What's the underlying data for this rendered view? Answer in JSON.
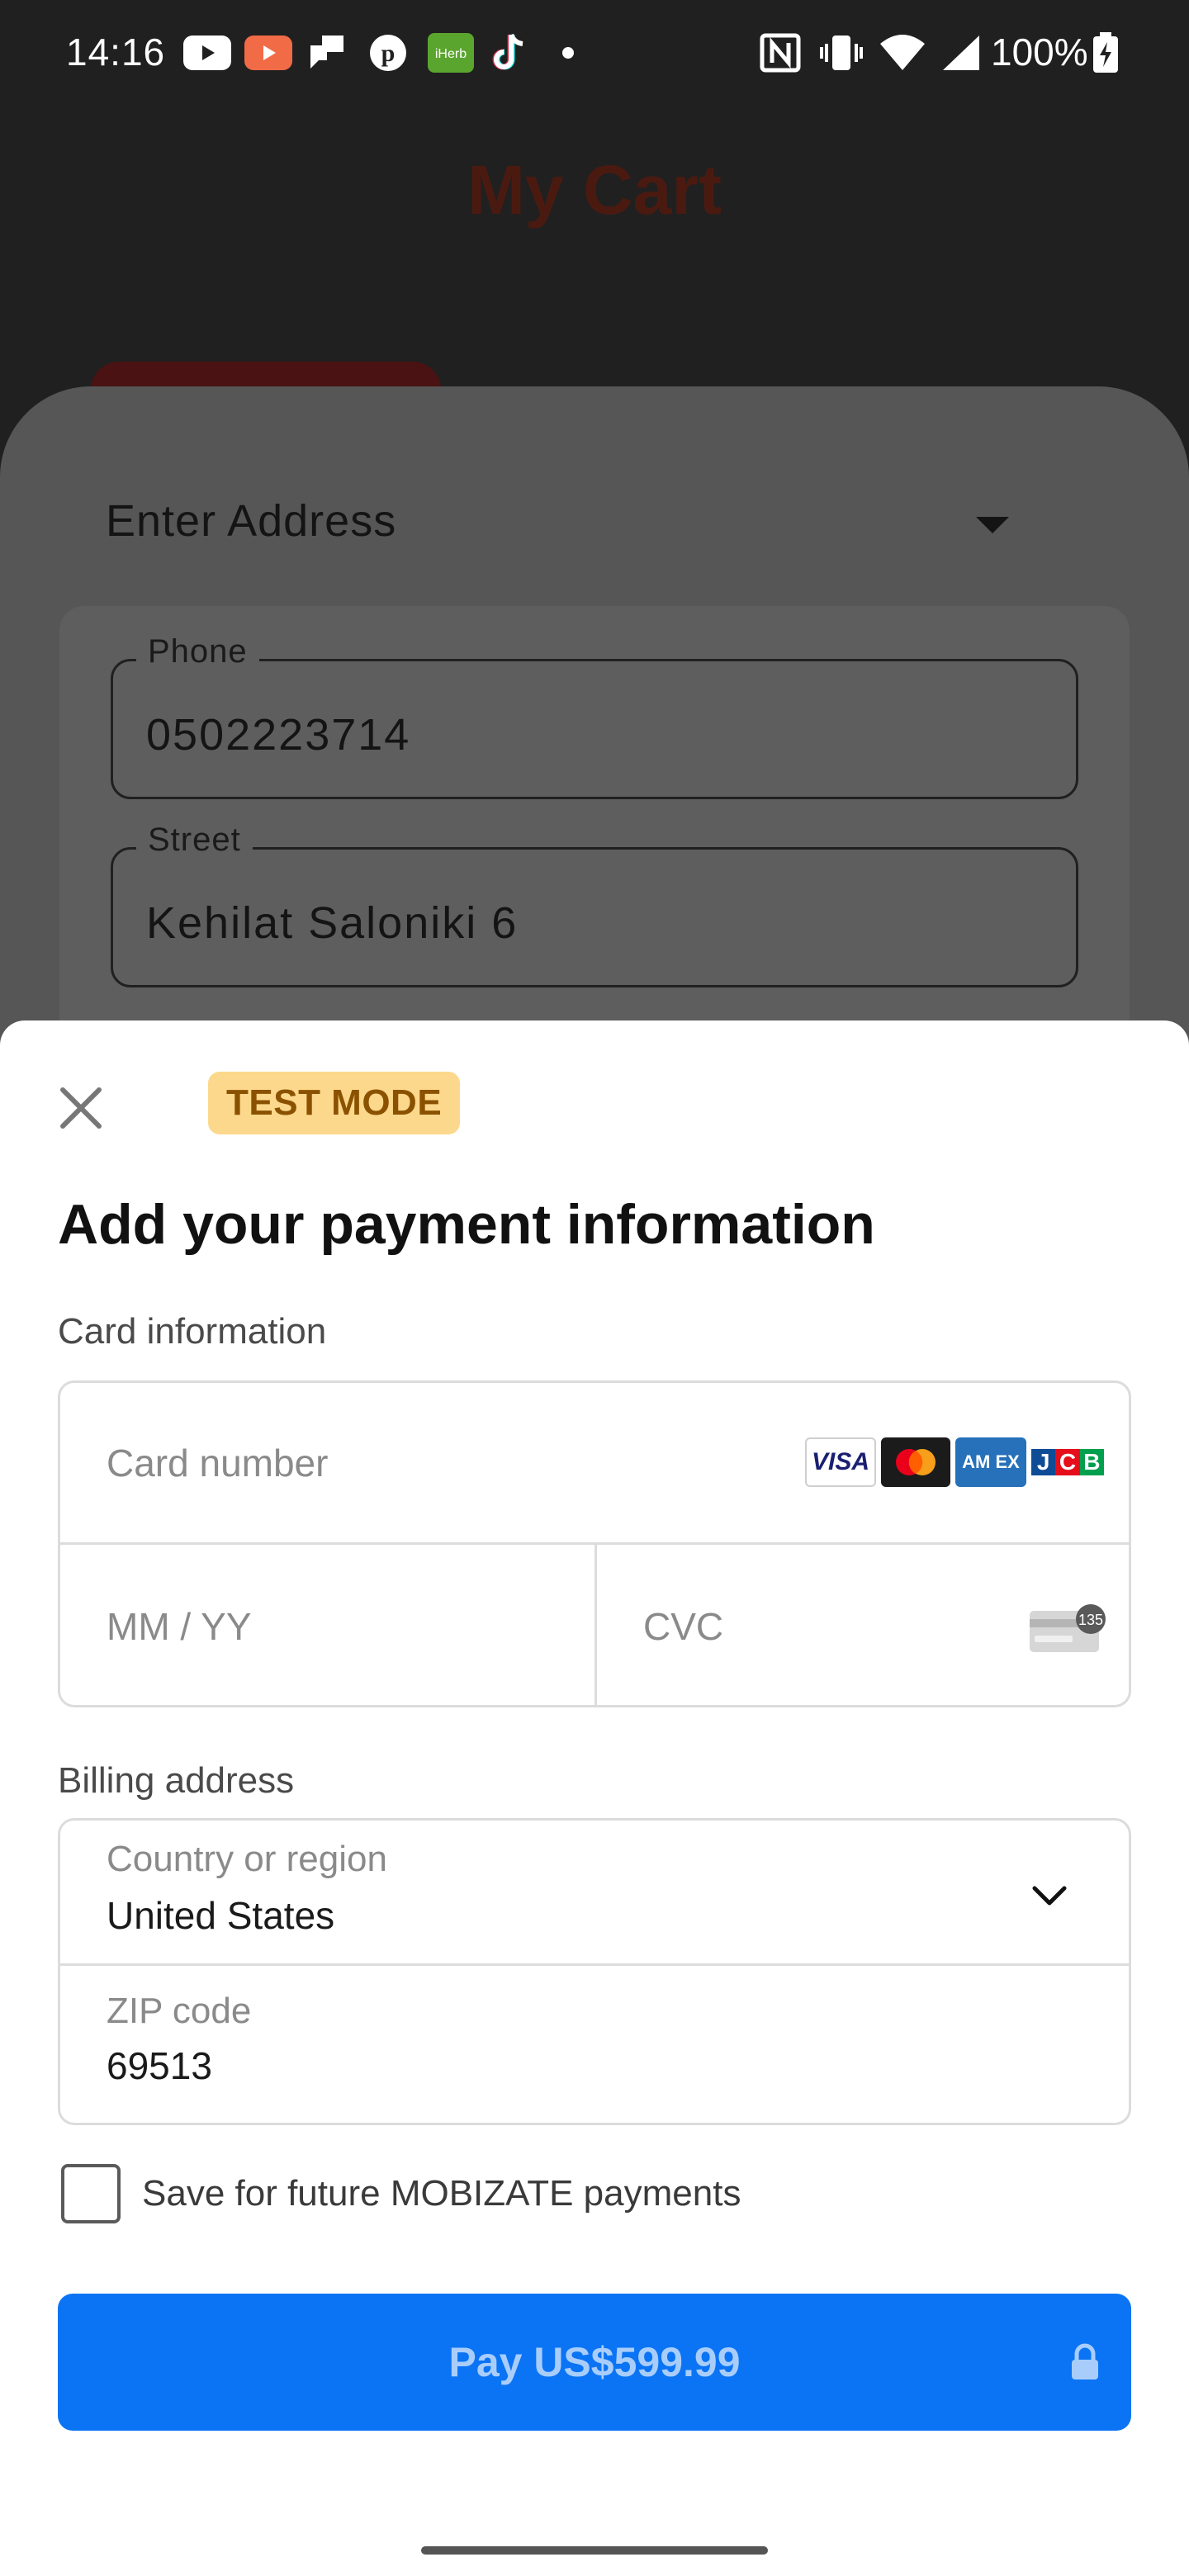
{
  "status_bar": {
    "time": "14:16",
    "battery": "100%",
    "notification_icons": [
      "youtube-icon",
      "youtube-studio-icon",
      "chat-icon",
      "pinterest-icon",
      "iherb-icon",
      "tiktok-icon",
      "dot-icon"
    ],
    "system_icons": [
      "nfc-icon",
      "vibrate-icon",
      "wifi-icon",
      "signal-icon",
      "battery-icon"
    ],
    "iherb_text": "iHerb"
  },
  "background": {
    "title": "My Cart",
    "address_dropdown_label": "Enter Address",
    "fields": [
      {
        "label": "Phone",
        "value": "0502223714"
      },
      {
        "label": "Street",
        "value": "Kehilat Saloniki 6"
      }
    ]
  },
  "payment": {
    "test_mode_badge": "TEST MODE",
    "title": "Add your payment information",
    "card_info_label": "Card information",
    "card_number_placeholder": "Card number",
    "card_brands": [
      "VISA",
      "mastercard",
      "AMEX",
      "JCB"
    ],
    "amex_text": "AM EX",
    "jcb_letters": [
      "J",
      "C",
      "B"
    ],
    "expiry_placeholder": "MM / YY",
    "cvc_placeholder": "CVC",
    "cvc_hint": "135",
    "billing_label": "Billing address",
    "country_label": "Country or region",
    "country_value": "United States",
    "zip_label": "ZIP code",
    "zip_value": "69513",
    "save_checkbox_label": "Save for future MOBIZATE payments",
    "save_checked": false,
    "pay_button_label": "Pay US$599.99"
  },
  "colors": {
    "accent": "#0a74f4",
    "badge_bg": "#fcd88c",
    "badge_text": "#8a5200"
  }
}
